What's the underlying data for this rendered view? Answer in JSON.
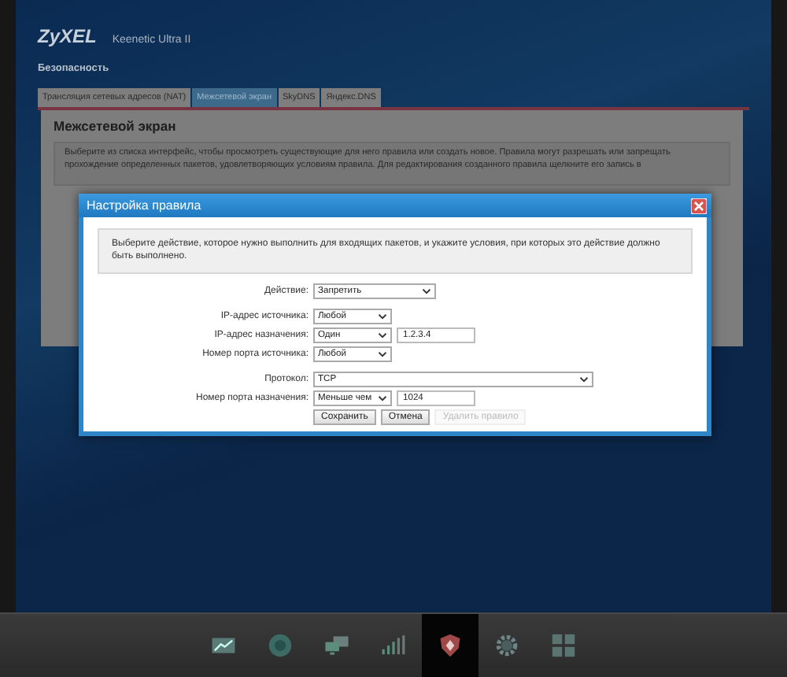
{
  "header": {
    "brand": "ZyXEL",
    "model": "Keenetic Ultra II",
    "section": "Безопасность"
  },
  "tabs": [
    {
      "label": "Трансляция сетевых адресов (NAT)",
      "selected": false
    },
    {
      "label": "Межсетевой экран",
      "selected": true
    },
    {
      "label": "SkyDNS",
      "selected": false
    },
    {
      "label": "Яндекс.DNS",
      "selected": false
    }
  ],
  "panel": {
    "title": "Межсетевой экран",
    "description": "Выберите из списка интерфейс, чтобы просмотреть существующие для него правила или создать новое. Правила могут разрешать или запрещать прохождение определенных пакетов, удовлетворяющих условиям правила. Для редактирования созданного правила щелкните его запись в"
  },
  "dialog": {
    "title": "Настройка правила",
    "intro": "Выберите действие, которое нужно выполнить для входящих пакетов, и укажите условия, при которых это действие должно быть выполнено.",
    "field_groups": [
      [
        {
          "label": "Действие:",
          "kind": "select",
          "value": "Запретить"
        }
      ],
      [
        {
          "label": "IP-адрес источника:",
          "kind": "select_small",
          "value": "Любой"
        },
        {
          "label": "IP-адрес назначения:",
          "kind": "select_input",
          "value": "Один",
          "input": "1.2.3.4"
        },
        {
          "label": "Номер порта источника:",
          "kind": "select_small",
          "value": "Любой"
        }
      ],
      [
        {
          "label": "Протокол:",
          "kind": "select_wide",
          "value": "TCP"
        },
        {
          "label": "Номер порта назначения:",
          "kind": "select_input",
          "value": "Меньше чем",
          "input": "1024"
        }
      ]
    ],
    "buttons": [
      {
        "label": "Сохранить",
        "disabled": false
      },
      {
        "label": "Отмена",
        "disabled": false
      },
      {
        "label": "Удалить правило",
        "disabled": true
      }
    ]
  },
  "taskbar": [
    {
      "kind": "chart",
      "selected": false
    },
    {
      "kind": "globe",
      "selected": false
    },
    {
      "kind": "network",
      "selected": false
    },
    {
      "kind": "signal",
      "selected": false
    },
    {
      "kind": "shield",
      "selected": true
    },
    {
      "kind": "gear",
      "selected": false
    },
    {
      "kind": "apps",
      "selected": false
    }
  ]
}
